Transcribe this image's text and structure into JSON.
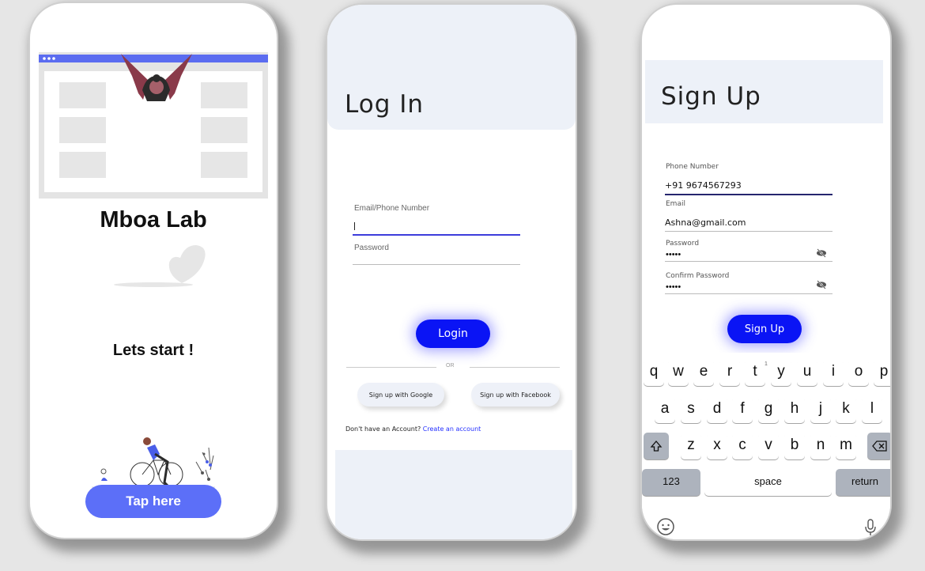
{
  "colors": {
    "accent": "#0a14f5",
    "tap_button": "#5c6ff8",
    "header_bg": "#edf1f8",
    "background": "#e6e6e6"
  },
  "welcome": {
    "title": "Mboa Lab",
    "subtitle": "Lets start !",
    "button": "Tap here"
  },
  "login": {
    "title": "Log In",
    "email_label": "Email/Phone Number",
    "email_value": "",
    "password_label": "Password",
    "password_value": "",
    "login_button": "Login",
    "or_text": "OR",
    "google_button": "Sign up with Google",
    "facebook_button": "Sign up with Facebook",
    "no_account_text": "Don't have an Account?",
    "create_account_link": "Create an account"
  },
  "signup": {
    "title": "Sign Up",
    "phone_label": "Phone Number",
    "phone_value": "+91 9674567293",
    "email_label": "Email",
    "email_value": "Ashna@gmail.com",
    "password_label": "Password",
    "password_dots": "•••••",
    "confirm_label": "Confirm Password",
    "confirm_dots": "•••••",
    "signup_button": "Sign Up"
  },
  "keyboard": {
    "row1": [
      "q",
      "w",
      "e",
      "r",
      "t",
      "y",
      "u",
      "i",
      "o",
      "p"
    ],
    "row2": [
      "a",
      "s",
      "d",
      "f",
      "g",
      "h",
      "j",
      "k",
      "l"
    ],
    "row3": [
      "z",
      "x",
      "c",
      "v",
      "b",
      "n",
      "m"
    ],
    "numbers_key": "123",
    "space_key": "space",
    "return_key": "return",
    "hint": "1",
    "shift_icon": "shift-icon",
    "backspace_icon": "backspace-icon",
    "emoji_icon": "emoji-icon",
    "mic_icon": "microphone-icon"
  }
}
